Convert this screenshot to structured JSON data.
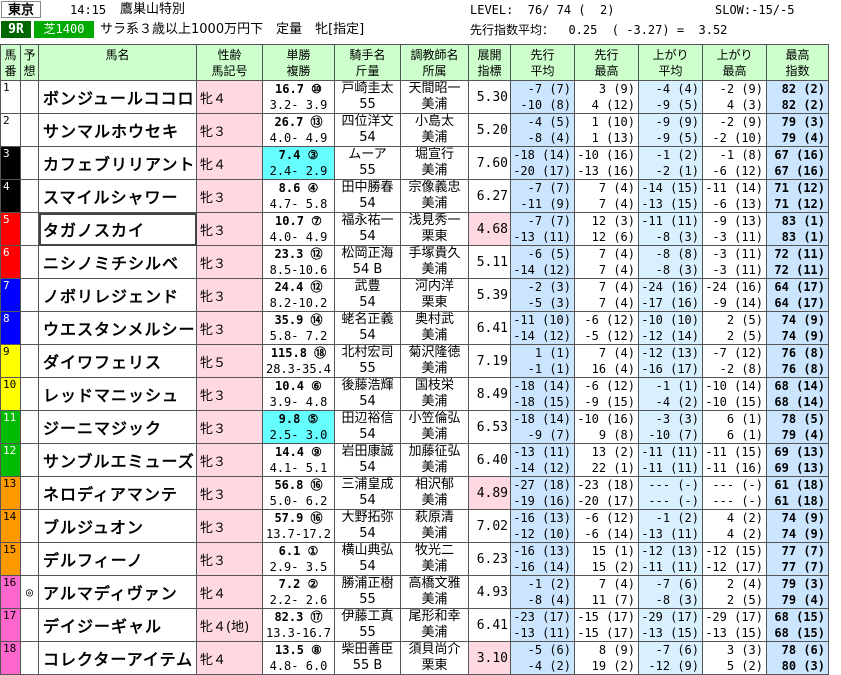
{
  "header": {
    "venue": "東京",
    "time": "14:15",
    "race_name": "鷹巣山特別",
    "level": "LEVEL:  76/ 74 (  2)",
    "slow": "SLOW:-15/-5",
    "race_no": "9R",
    "course": "芝1400",
    "conditions": "サラ系３歳以上1000万円下　定量　牝[指定]",
    "pace": "先行指数平均：  0.25  ( -3.27) =  3.52",
    "colors": {
      "venue_bg": "#ffffff",
      "race_no_bg": "#006600",
      "course_bg": "#00aa00"
    }
  },
  "columns": [
    {
      "l1": "馬",
      "l2": "番"
    },
    {
      "l1": "予",
      "l2": "想"
    },
    {
      "l1": "馬名",
      "l2": ""
    },
    {
      "l1": "性齢",
      "l2": "馬記号"
    },
    {
      "l1": "単勝",
      "l2": "複勝"
    },
    {
      "l1": "騎手名",
      "l2": "斤量"
    },
    {
      "l1": "調教師名",
      "l2": "所属"
    },
    {
      "l1": "展開",
      "l2": "指標"
    },
    {
      "l1": "先行",
      "l2": "平均"
    },
    {
      "l1": "先行",
      "l2": "最高"
    },
    {
      "l1": "上がり",
      "l2": "平均"
    },
    {
      "l1": "上がり",
      "l2": "最高"
    },
    {
      "l1": "最高",
      "l2": "指数"
    }
  ],
  "rows": [
    {
      "num": "1",
      "mark": "",
      "name": "ボンジュールココロ",
      "sex": "牝４",
      "w1": "16.7 ⑩",
      "w2": "3.2- 3.9",
      "j1": "戸崎圭太",
      "j2": "55",
      "t1": "天間昭一",
      "t2": "美浦",
      "ix": "5.30",
      "a1": "-7 (7)",
      "a2": "-10 (8)",
      "b1": "3 (9)",
      "b2": "4 (12)",
      "c1": "-4 (4)",
      "c2": "-9 (5)",
      "d1": "-2 (9)",
      "d2": "4 (3)",
      "e1": "82 (2)",
      "e2": "82 (2)"
    },
    {
      "num": "2",
      "mark": "",
      "name": "サンマルホウセキ",
      "sex": "牝３",
      "w1": "26.7 ⑬",
      "w2": "4.0- 4.9",
      "j1": "四位洋文",
      "j2": "54",
      "t1": "小島太",
      "t2": "美浦",
      "ix": "5.20",
      "a1": "-4 (5)",
      "a2": "-8 (4)",
      "b1": "1 (10)",
      "b2": "1 (13)",
      "c1": "-9 (9)",
      "c2": "-9 (5)",
      "d1": "-2 (9)",
      "d2": "-2 (10)",
      "e1": "79 (3)",
      "e2": "79 (4)"
    },
    {
      "num": "3",
      "mark": "",
      "name": "カフェブリリアント",
      "sex": "牝４",
      "w1": "7.4 ③",
      "w2": "2.4- 2.9",
      "j1": "ムーア",
      "j2": "55",
      "t1": "堀宣行",
      "t2": "美浦",
      "ix": "7.60",
      "a1": "-18 (14)",
      "a2": "-20 (17)",
      "b1": "-10 (16)",
      "b2": "-13 (16)",
      "c1": "-1 (2)",
      "c2": "-2 (1)",
      "d1": "-1 (8)",
      "d2": "-6 (12)",
      "e1": "67 (16)",
      "e2": "67 (16)"
    },
    {
      "num": "4",
      "mark": "",
      "name": "スマイルシャワー",
      "sex": "牝３",
      "w1": "8.6 ④",
      "w2": "4.7- 5.8",
      "j1": "田中勝春",
      "j2": "54",
      "t1": "宗像義忠",
      "t2": "美浦",
      "ix": "6.27",
      "a1": "-7 (7)",
      "a2": "-11 (9)",
      "b1": "7 (4)",
      "b2": "7 (4)",
      "c1": "-14 (15)",
      "c2": "-13 (15)",
      "d1": "-11 (14)",
      "d2": "-6 (13)",
      "e1": "71 (12)",
      "e2": "71 (12)"
    },
    {
      "num": "5",
      "mark": "",
      "name": "タガノスカイ",
      "sex": "牝３",
      "w1": "10.7 ⑦",
      "w2": "4.0- 4.9",
      "j1": "福永祐一",
      "j2": "54",
      "t1": "浅見秀一",
      "t2": "栗東",
      "ix": "4.68",
      "a1": "-7 (7)",
      "a2": "-13 (11)",
      "b1": "12 (3)",
      "b2": "12 (6)",
      "c1": "-11 (11)",
      "c2": "-8 (3)",
      "d1": "-9 (13)",
      "d2": "-3 (11)",
      "e1": "83 (1)",
      "e2": "83 (1)"
    },
    {
      "num": "6",
      "mark": "",
      "name": "ニシノミチシルベ",
      "sex": "牝３",
      "w1": "23.3 ⑫",
      "w2": "8.5-10.6",
      "j1": "松岡正海",
      "j2": "54 B",
      "t1": "手塚貴久",
      "t2": "美浦",
      "ix": "5.11",
      "a1": "-6 (5)",
      "a2": "-14 (12)",
      "b1": "7 (4)",
      "b2": "7 (4)",
      "c1": "-8 (8)",
      "c2": "-8 (3)",
      "d1": "-3 (11)",
      "d2": "-3 (11)",
      "e1": "72 (11)",
      "e2": "72 (11)"
    },
    {
      "num": "7",
      "mark": "",
      "name": "ノボリレジェンド",
      "sex": "牝３",
      "w1": "24.4 ⑫",
      "w2": "8.2-10.2",
      "j1": "武豊",
      "j2": "54",
      "t1": "河内洋",
      "t2": "栗東",
      "ix": "5.39",
      "a1": "-2 (3)",
      "a2": "-5 (3)",
      "b1": "7 (4)",
      "b2": "7 (4)",
      "c1": "-24 (16)",
      "c2": "-17 (16)",
      "d1": "-24 (16)",
      "d2": "-9 (14)",
      "e1": "64 (17)",
      "e2": "64 (17)"
    },
    {
      "num": "8",
      "mark": "",
      "name": "ウエスタンメルシー",
      "sex": "牝３",
      "w1": "35.9 ⑭",
      "w2": "5.8- 7.2",
      "j1": "蛯名正義",
      "j2": "54",
      "t1": "奥村武",
      "t2": "美浦",
      "ix": "6.41",
      "a1": "-11 (10)",
      "a2": "-14 (12)",
      "b1": "-6 (12)",
      "b2": "-5 (12)",
      "c1": "-10 (10)",
      "c2": "-12 (14)",
      "d1": "2 (5)",
      "d2": "2 (5)",
      "e1": "74 (9)",
      "e2": "74 (9)"
    },
    {
      "num": "9",
      "mark": "",
      "name": "ダイワフェリス",
      "sex": "牝５",
      "w1": "115.8 ⑱",
      "w2": "28.3-35.4",
      "j1": "北村宏司",
      "j2": "55",
      "t1": "菊沢隆徳",
      "t2": "美浦",
      "ix": "7.19",
      "a1": "1 (1)",
      "a2": "-1 (1)",
      "b1": "7 (4)",
      "b2": "16 (4)",
      "c1": "-12 (13)",
      "c2": "-16 (17)",
      "d1": "-7 (12)",
      "d2": "-2 (8)",
      "e1": "76 (8)",
      "e2": "76 (8)"
    },
    {
      "num": "10",
      "mark": "",
      "name": "レッドマニッシュ",
      "sex": "牝３",
      "w1": "10.4 ⑥",
      "w2": "3.9- 4.8",
      "j1": "後藤浩輝",
      "j2": "54",
      "t1": "国枝栄",
      "t2": "美浦",
      "ix": "8.49",
      "a1": "-18 (14)",
      "a2": "-18 (15)",
      "b1": "-6 (12)",
      "b2": "-9 (15)",
      "c1": "-1 (1)",
      "c2": "-4 (2)",
      "d1": "-10 (14)",
      "d2": "-10 (15)",
      "e1": "68 (14)",
      "e2": "68 (14)"
    },
    {
      "num": "11",
      "mark": "",
      "name": "ジーニマジック",
      "sex": "牝３",
      "w1": "9.8 ⑤",
      "w2": "2.5- 3.0",
      "j1": "田辺裕信",
      "j2": "54",
      "t1": "小笠倫弘",
      "t2": "美浦",
      "ix": "6.53",
      "a1": "-18 (14)",
      "a2": "-9 (7)",
      "b1": "-10 (16)",
      "b2": "9 (8)",
      "c1": "-3 (3)",
      "c2": "-10 (7)",
      "d1": "6 (1)",
      "d2": "6 (1)",
      "e1": "78 (5)",
      "e2": "79 (4)"
    },
    {
      "num": "12",
      "mark": "",
      "name": "サンブルエミューズ",
      "sex": "牝３",
      "w1": "14.4 ⑨",
      "w2": "4.1- 5.1",
      "j1": "岩田康誠",
      "j2": "54",
      "t1": "加藤征弘",
      "t2": "美浦",
      "ix": "6.40",
      "a1": "-13 (11)",
      "a2": "-14 (12)",
      "b1": "13 (2)",
      "b2": "22 (1)",
      "c1": "-11 (11)",
      "c2": "-11 (11)",
      "d1": "-11 (15)",
      "d2": "-11 (16)",
      "e1": "69 (13)",
      "e2": "69 (13)"
    },
    {
      "num": "13",
      "mark": "",
      "name": "ネロディアマンテ",
      "sex": "牝３",
      "w1": "56.8 ⑯",
      "w2": "5.0- 6.2",
      "j1": "三浦皇成",
      "j2": "54",
      "t1": "相沢郁",
      "t2": "美浦",
      "ix": "4.89",
      "a1": "-27 (18)",
      "a2": "-19 (16)",
      "b1": "-23 (18)",
      "b2": "-20 (17)",
      "c1": "--- (-)",
      "c2": "--- (-)",
      "d1": "--- (-)",
      "d2": "--- (-)",
      "e1": "61 (18)",
      "e2": "61 (18)"
    },
    {
      "num": "14",
      "mark": "",
      "name": "ブルジュオン",
      "sex": "牝３",
      "w1": "57.9 ⑯",
      "w2": "13.7-17.2",
      "j1": "大野拓弥",
      "j2": "54",
      "t1": "萩原清",
      "t2": "美浦",
      "ix": "7.02",
      "a1": "-16 (13)",
      "a2": "-12 (10)",
      "b1": "-6 (12)",
      "b2": "-6 (14)",
      "c1": "-1 (2)",
      "c2": "-13 (11)",
      "d1": "4 (2)",
      "d2": "4 (2)",
      "e1": "74 (9)",
      "e2": "74 (9)"
    },
    {
      "num": "15",
      "mark": "",
      "name": "デルフィーノ",
      "sex": "牝３",
      "w1": "6.1 ①",
      "w2": "2.9- 3.5",
      "j1": "横山典弘",
      "j2": "54",
      "t1": "牧光二",
      "t2": "美浦",
      "ix": "6.23",
      "a1": "-16 (13)",
      "a2": "-16 (14)",
      "b1": "15 (1)",
      "b2": "15 (2)",
      "c1": "-12 (13)",
      "c2": "-11 (11)",
      "d1": "-12 (15)",
      "d2": "-12 (17)",
      "e1": "77 (7)",
      "e2": "77 (7)"
    },
    {
      "num": "16",
      "mark": "◎",
      "name": "アルマディヴァン",
      "sex": "牝４",
      "w1": "7.2 ②",
      "w2": "2.2- 2.6",
      "j1": "勝浦正樹",
      "j2": "55",
      "t1": "高橋文雅",
      "t2": "美浦",
      "ix": "4.93",
      "a1": "-1 (2)",
      "a2": "-8 (4)",
      "b1": "7 (4)",
      "b2": "11 (7)",
      "c1": "-7 (6)",
      "c2": "-8 (3)",
      "d1": "2 (4)",
      "d2": "2 (5)",
      "e1": "79 (3)",
      "e2": "79 (4)"
    },
    {
      "num": "17",
      "mark": "",
      "name": "デイジーギャル",
      "sex": "牝４(地)",
      "w1": "82.3 ⑰",
      "w2": "13.3-16.7",
      "j1": "伊藤工真",
      "j2": "55",
      "t1": "尾形和幸",
      "t2": "美浦",
      "ix": "6.41",
      "a1": "-23 (17)",
      "a2": "-13 (11)",
      "b1": "-15 (17)",
      "b2": "-15 (17)",
      "c1": "-29 (17)",
      "c2": "-13 (15)",
      "d1": "-29 (17)",
      "d2": "-13 (15)",
      "e1": "68 (15)",
      "e2": "68 (15)"
    },
    {
      "num": "18",
      "mark": "",
      "name": "コレクターアイテム",
      "sex": "牝４",
      "w1": "13.5 ⑧",
      "w2": "4.8- 6.0",
      "j1": "柴田善臣",
      "j2": "55 B",
      "t1": "須貝尚介",
      "t2": "栗東",
      "ix": "3.10",
      "a1": "-5 (6)",
      "a2": "-4 (2)",
      "b1": "8 (9)",
      "b2": "19 (2)",
      "c1": "-7 (6)",
      "c2": "-12 (9)",
      "d1": "3 (3)",
      "d2": "5 (2)",
      "e1": "78 (6)",
      "e2": "80 (3)"
    }
  ],
  "frame_colors": [
    "#ffffff",
    "#ffffff",
    "#000000",
    "#000000",
    "#ff0000",
    "#ff0000",
    "#0000ff",
    "#0000ff",
    "#ffff00",
    "#ffff00",
    "#00bb00",
    "#00bb00",
    "#ff9900",
    "#ff9900",
    "#ff9900",
    "#ff66cc",
    "#ff66cc",
    "#ff66cc"
  ]
}
